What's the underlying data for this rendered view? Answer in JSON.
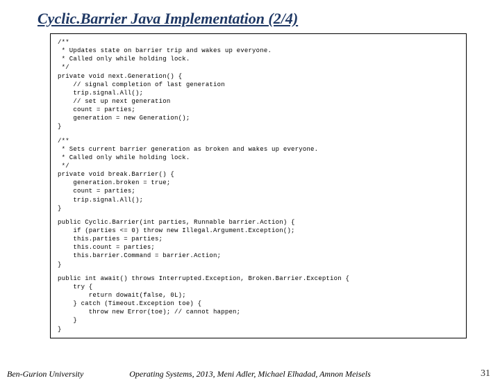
{
  "title": "Cyclic.Barrier Java Implementation (2/4)",
  "code": {
    "block1": "/**\n * Updates state on barrier trip and wakes up everyone.\n * Called only while holding lock.\n */\nprivate void next.Generation() {\n    // signal completion of last generation\n    trip.signal.All();\n    // set up next generation\n    count = parties;\n    generation = new Generation();\n}",
    "block2": "/**\n * Sets current barrier generation as broken and wakes up everyone.\n * Called only while holding lock.\n */\nprivate void break.Barrier() {\n    generation.broken = true;\n    count = parties;\n    trip.signal.All();\n}",
    "block3": "public Cyclic.Barrier(int parties, Runnable barrier.Action) {\n    if (parties <= 0) throw new Illegal.Argument.Exception();\n    this.parties = parties;\n    this.count = parties;\n    this.barrier.Command = barrier.Action;\n}",
    "block4": "public int await() throws Interrupted.Exception, Broken.Barrier.Exception {\n    try {\n        return dowait(false, 0L);\n    } catch (Timeout.Exception toe) {\n        throw new Error(toe); // cannot happen;\n    }\n}"
  },
  "footer": {
    "left": "Ben-Gurion University",
    "center": "Operating Systems, 2013, Meni Adler, Michael Elhadad, Amnon Meisels",
    "right": "31"
  }
}
